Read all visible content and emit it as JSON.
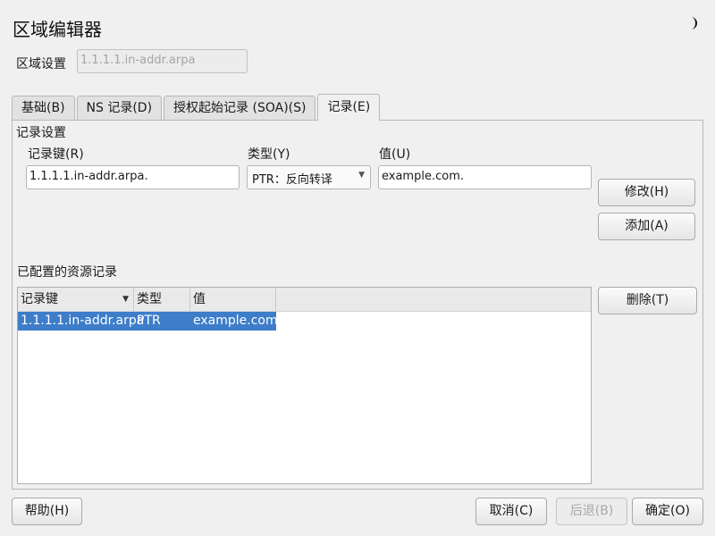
{
  "window": {
    "title": "区域编辑器",
    "corner_icon": "moon-icon"
  },
  "zone": {
    "label": "区域设置",
    "value": "1.1.1.1.in-addr.arpa"
  },
  "tabs": [
    {
      "label": "基础(B)",
      "active": false
    },
    {
      "label": "NS 记录(D)",
      "active": false
    },
    {
      "label": "授权起始记录 (SOA)(S)",
      "active": false
    },
    {
      "label": "记录(E)",
      "active": true
    }
  ],
  "record_settings": {
    "title": "记录设置",
    "key_label": "记录键(R)",
    "key_value": "1.1.1.1.in-addr.arpa.",
    "type_label": "类型(Y)",
    "type_value": "PTR：反向转译",
    "value_label": "值(U)",
    "value_value": "example.com."
  },
  "buttons": {
    "modify": "修改(H)",
    "add": "添加(A)",
    "delete": "删除(T)",
    "help": "帮助(H)",
    "cancel": "取消(C)",
    "back": "后退(B)",
    "ok": "确定(O)"
  },
  "configured": {
    "title": "已配置的资源记录",
    "columns": [
      "记录键",
      "类型",
      "值"
    ],
    "rows": [
      {
        "key": "1.1.1.1.in-addr.arpa",
        "type": "PTR",
        "value": "example.com",
        "selected": true
      }
    ]
  },
  "colors": {
    "selection": "#3d7dc9",
    "background": "#f0f0f0"
  }
}
